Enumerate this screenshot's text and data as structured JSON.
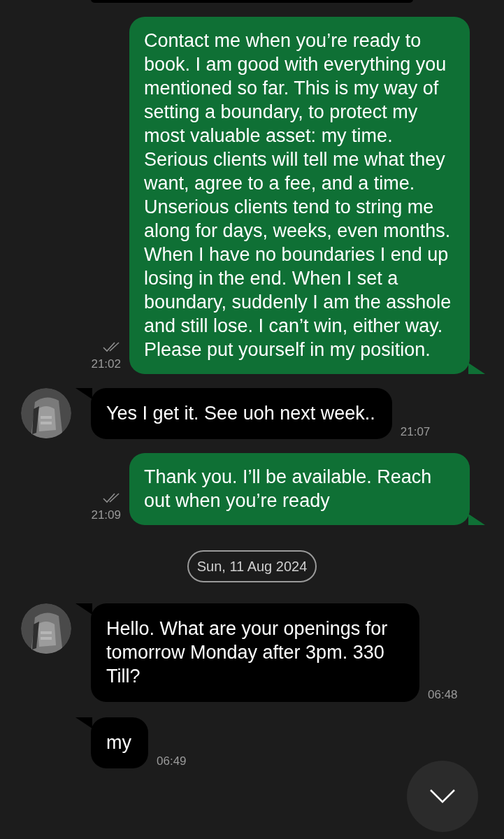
{
  "items": [
    {
      "kind": "partial"
    },
    {
      "kind": "sent",
      "text": "Contact me when you’re ready to book. I am good with everything you mentioned so far. This is my way of setting a boundary, to protect my most valuable asset: my time. Serious clients will tell me what they want, agree to a fee, and a time. Unserious clients tend to string me along for days, weeks, even months. When I have no boundaries I end up losing in the end. When I set a boundary, suddenly I am the asshole and still lose. I can’t win, either way. Please put yourself in my position.",
      "time": "21:02",
      "read": true
    },
    {
      "kind": "received",
      "text": "Yes I get it. See uoh next week..",
      "time": "21:07",
      "show_avatar": true
    },
    {
      "kind": "sent",
      "text": "Thank you. I’ll be available. Reach out when you’re ready",
      "time": "21:09",
      "read": true
    },
    {
      "kind": "date",
      "text": "Sun, 11 Aug 2024"
    },
    {
      "kind": "received",
      "text": "Hello. What are your openings for tomorrow Monday after 3pm. 330 Till?",
      "time": "06:48",
      "show_avatar": true
    },
    {
      "kind": "received",
      "text": "my",
      "time": "06:49",
      "show_avatar": false
    }
  ]
}
